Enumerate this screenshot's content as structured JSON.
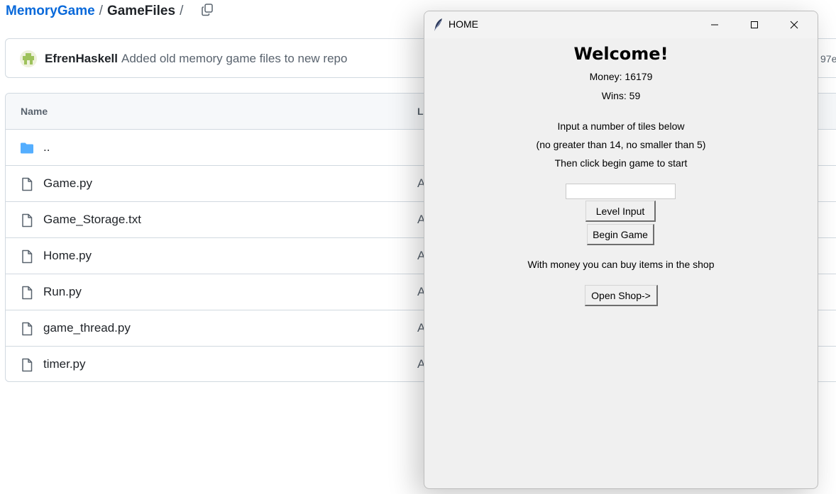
{
  "breadcrumb": {
    "repo": "MemoryGame",
    "sep1": "/",
    "folder": "GameFiles",
    "sep2": "/"
  },
  "commit": {
    "author": "EfrenHaskell",
    "message": "Added old memory game files to new repo",
    "hash_fragment": "97e"
  },
  "table": {
    "col_name": "Name",
    "col_last": "La",
    "rows": [
      {
        "name": "..",
        "type": "folder",
        "last": ""
      },
      {
        "name": "Game.py",
        "type": "file",
        "last": "A"
      },
      {
        "name": "Game_Storage.txt",
        "type": "file",
        "last": "A"
      },
      {
        "name": "Home.py",
        "type": "file",
        "last": "A"
      },
      {
        "name": "Run.py",
        "type": "file",
        "last": "A"
      },
      {
        "name": "game_thread.py",
        "type": "file",
        "last": "A"
      },
      {
        "name": "timer.py",
        "type": "file",
        "last": "A"
      }
    ]
  },
  "tk": {
    "title": "HOME",
    "welcome": "Welcome!",
    "money": "Money: 16179",
    "wins": "Wins: 59",
    "instruction1": "Input a number of tiles below",
    "instruction2": "(no greater than 14, no smaller than 5)",
    "instruction3": "Then click begin game to start",
    "input_value": "",
    "level_input_button": "Level Input",
    "begin_game_button": "Begin Game",
    "shop_text": "With money you can buy items in the shop",
    "open_shop_button": "Open Shop->"
  },
  "colors": {
    "link": "#0969da",
    "folder": "#54aeff",
    "window_bg": "#f0f0f0"
  },
  "icons": {
    "copy": "copy-icon",
    "folder": "folder-icon",
    "file": "file-icon",
    "feather": "feather-icon",
    "minimize": "minimize-icon",
    "maximize": "maximize-icon",
    "close": "close-icon"
  }
}
